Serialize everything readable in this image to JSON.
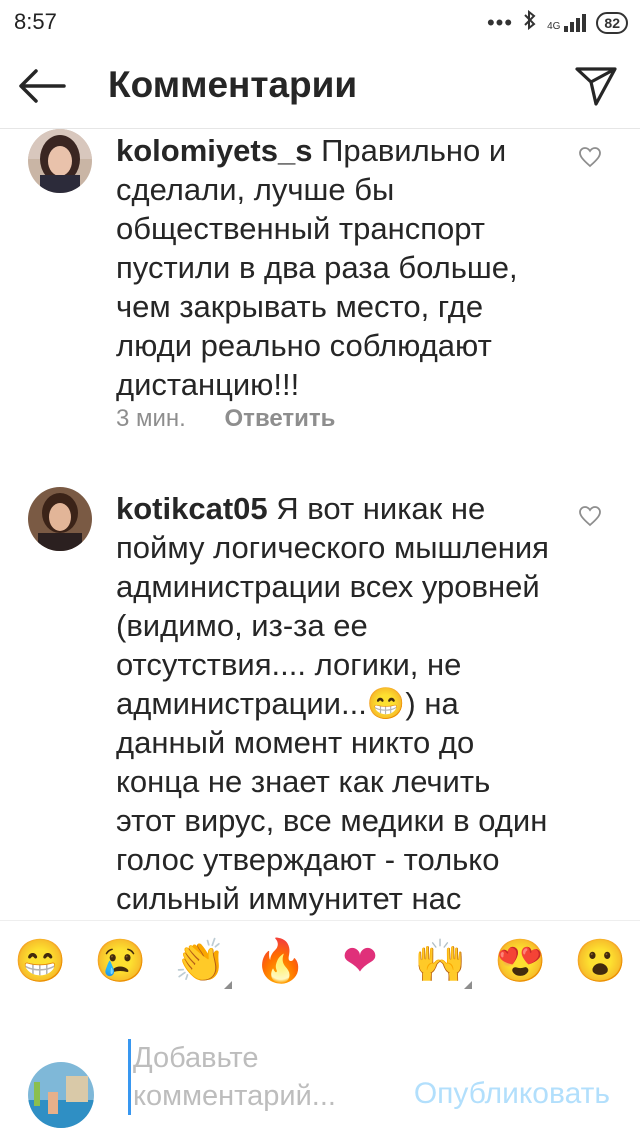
{
  "status_bar": {
    "time": "8:57",
    "battery": "82",
    "network": "4G"
  },
  "header": {
    "title": "Комментарии"
  },
  "comments": [
    {
      "username": "kolomiyets_s",
      "text": "Правильно и сделали, лучше бы общественный транспорт пустили в два  раза больше, чем закрывать место, где люди реально соблюдают дистанцию!!!",
      "time": "3 мин.",
      "reply": "Ответить"
    },
    {
      "username": "kotikcat05",
      "text": "Я вот никак не пойму логического мышления администрации всех уровней (видимо, из-за ее отсутствия.... логики, не администрации...😁) на данный момент никто до конца не знает как лечить этот вирус, все медики в один голос утверждают - только сильный иммунитет нас спасёт! Тогда в ход"
    }
  ],
  "emoji_bar": [
    "😁",
    "😢",
    "👏",
    "🔥",
    "❤",
    "🙌",
    "😍",
    "😮"
  ],
  "composer": {
    "placeholder": "Добавьте комментарий...",
    "publish": "Опубликовать"
  },
  "colors": {
    "accent": "#3897f0",
    "publish_disabled": "#b2dffc",
    "meta": "#8e8e8e"
  }
}
